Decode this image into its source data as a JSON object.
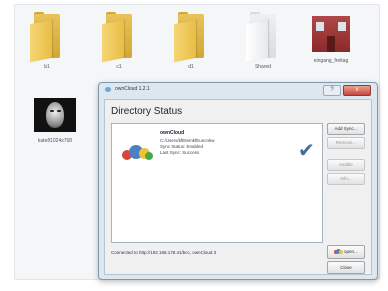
{
  "desktop": {
    "icons": [
      {
        "label": "b1",
        "kind": "folder"
      },
      {
        "label": "c1",
        "kind": "folder"
      },
      {
        "label": "d1",
        "kind": "folder"
      },
      {
        "label": "Shared",
        "kind": "folder-white"
      },
      {
        "label": "eingang_freitag",
        "kind": "photo"
      },
      {
        "label": "kate81024x768",
        "kind": "photo"
      }
    ]
  },
  "dialog": {
    "title": "ownCloud 1.2.1",
    "help_label": "?",
    "close_label": "x",
    "heading": "Directory Status",
    "entry": {
      "name": "ownCloud",
      "path": "C:/Users/kfEtemkfEuncnkw",
      "sync_status": "Sync Status: Enabled",
      "last_sync": "Last Sync: Success"
    },
    "buttons": {
      "add_sync": "Add Sync...",
      "remove": "Remove...",
      "enable": "enable",
      "info": "info..."
    },
    "status_text": "Connected to http://192.168.178.41/bcc, ownCloud 3",
    "open_label": "open...",
    "close_btn_label": "Close"
  },
  "colors": {
    "dialog_bg": "#dde7ef",
    "checkmark": "#3e6f9e",
    "logo_blue": "#4e7fc3",
    "logo_red": "#d6473b",
    "logo_yellow": "#f0c23a",
    "logo_green": "#4aa64b"
  }
}
